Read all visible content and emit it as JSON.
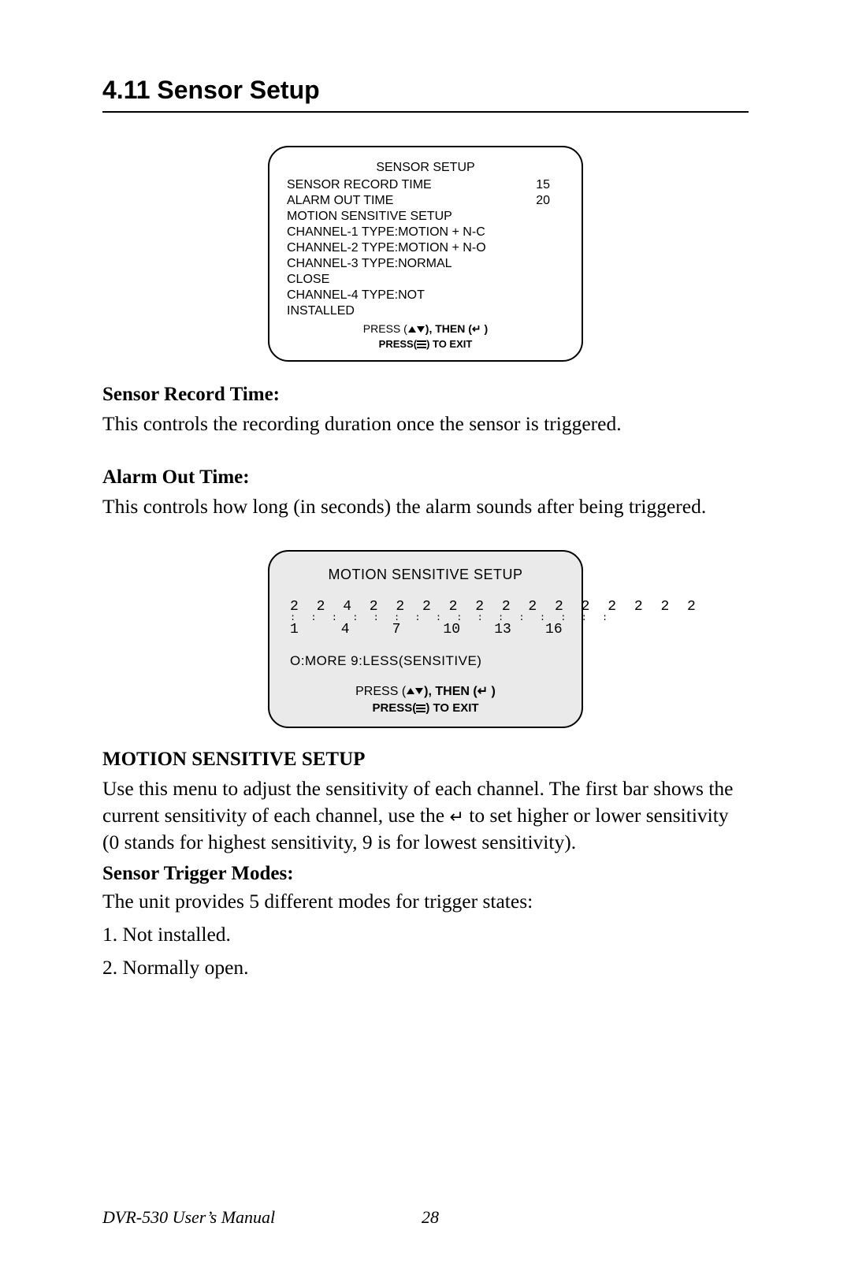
{
  "heading": "4.11  Sensor Setup",
  "screen1": {
    "title": "SENSOR SETUP",
    "rows": [
      {
        "label": "SENSOR RECORD TIME",
        "value": "15"
      },
      {
        "label": "ALARM OUT TIME",
        "value": "20"
      }
    ],
    "lines": [
      "MOTION SENSITIVE SETUP",
      "CHANNEL-1   TYPE:MOTION + N-C",
      "CHANNEL-2   TYPE:MOTION + N-O",
      "CHANNEL-3   TYPE:NORMAL",
      "CLOSE",
      "CHANNEL-4   TYPE:NOT",
      "INSTALLED"
    ],
    "press1_a": "PRESS (",
    "press1_b": "), ",
    "press1_then": "THEN (",
    "press1_c": "↵",
    "press1_d": " )",
    "press2_a": "PRESS(",
    "press2_b": ") TO EXIT"
  },
  "sensor_record_label": "Sensor Record Time:",
  "sensor_record_text": "This controls the recording duration once the sensor is triggered.",
  "alarm_out_label": "Alarm Out Time:",
  "alarm_out_text": "This controls how long (in seconds) the alarm sounds after being triggered.",
  "screen2": {
    "title": "MOTION SENSITIVE SETUP",
    "digits": "2 2 4 2 2 2 2 2 2 2 2 2 2 2 2 2",
    "dots": ": : : : : : : : : : : : : : : :",
    "indices": "1     4     7     10    13    16",
    "legend": "O:MORE    9:LESS(SENSITIVE)",
    "press1_a": "PRESS (",
    "press1_b": "), ",
    "press1_then": "THEN (",
    "press1_c": "↵",
    "press1_d": " )",
    "press2_a": "PRESS(",
    "press2_b": ") TO EXIT"
  },
  "motion_heading": "MOTION SENSITIVE SETUP",
  "motion_text_a": "Use this menu to adjust the sensitivity of each channel. The first bar shows the current sensitivity of each channel, use the ",
  "motion_enter": "↵",
  "motion_text_b": " to set higher or lower sensitivity (0 stands for highest sensitivity, 9 is for lowest sensitivity).",
  "trigger_label": "Sensor Trigger Modes:",
  "trigger_intro": "The unit provides 5 different modes for trigger states:",
  "trigger_items": [
    "1. Not installed.",
    "2. Normally open."
  ],
  "footer_left": "DVR-530 User’s Manual",
  "footer_page": "28"
}
